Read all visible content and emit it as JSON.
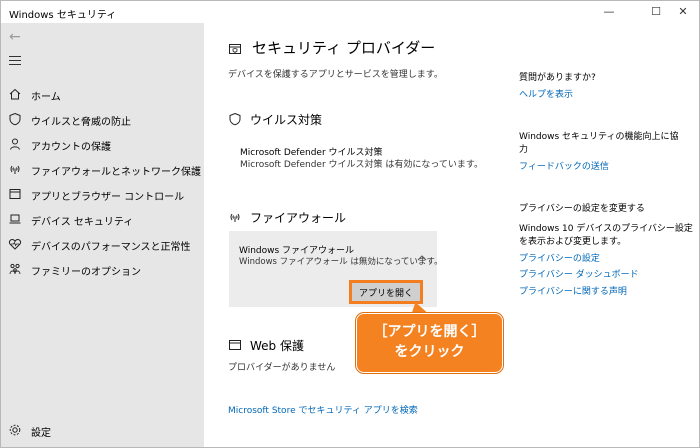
{
  "window": {
    "title": "Windows セキュリティ",
    "minimize_glyph": "—",
    "maximize_glyph": "☐",
    "close_glyph": "✕"
  },
  "sidebar": {
    "back_icon": "arrow-left-icon",
    "menu_icon": "hamburger-icon",
    "items": [
      {
        "label": "ホーム",
        "icon": "home-icon"
      },
      {
        "label": "ウイルスと脅威の防止",
        "icon": "shield-icon"
      },
      {
        "label": "アカウントの保護",
        "icon": "person-icon"
      },
      {
        "label": "ファイアウォールとネットワーク保護",
        "icon": "wifi-icon"
      },
      {
        "label": "アプリとブラウザー コントロール",
        "icon": "app-window-icon"
      },
      {
        "label": "デバイス セキュリティ",
        "icon": "laptop-icon"
      },
      {
        "label": "デバイスのパフォーマンスと正常性",
        "icon": "heart-icon"
      },
      {
        "label": "ファミリーのオプション",
        "icon": "family-icon"
      }
    ],
    "settings_label": "設定",
    "settings_icon": "gear-icon"
  },
  "main": {
    "title": "セキュリティ プロバイダー",
    "subtitle": "デバイスを保護するアプリとサービスを管理します。",
    "antivirus": {
      "heading": "ウイルス対策",
      "provider_name": "Microsoft Defender ウイルス対策",
      "provider_status": "Microsoft Defender ウイルス対策 は有効になっています。"
    },
    "firewall": {
      "heading": "ファイアウォール",
      "provider_name": "Windows ファイアウォール",
      "provider_status": "Windows ファイアウォール は無効になっています。",
      "open_app_label": "アプリを開く"
    },
    "web": {
      "heading": "Web 保護",
      "status": "プロバイダーがありません"
    },
    "store_link": "Microsoft Store でセキュリティ アプリを検索"
  },
  "callout": {
    "line1": "［アプリを開く］",
    "line2": "をクリック",
    "color": "#f58220"
  },
  "right_panel": {
    "question_heading": "質問がありますか?",
    "help_link": "ヘルプを表示",
    "improve_heading_line1": "Windows セキュリティの機能向上に協",
    "improve_heading_line2": "力",
    "feedback_link": "フィードバックの送信",
    "privacy_heading": "プライバシーの設定を変更する",
    "privacy_text_line1": "Windows 10 デバイスのプライバシー設定",
    "privacy_text_line2": "を表示および変更します。",
    "privacy_links": [
      "プライバシーの設定",
      "プライバシー ダッシュボード",
      "プライバシーに関する声明"
    ]
  }
}
